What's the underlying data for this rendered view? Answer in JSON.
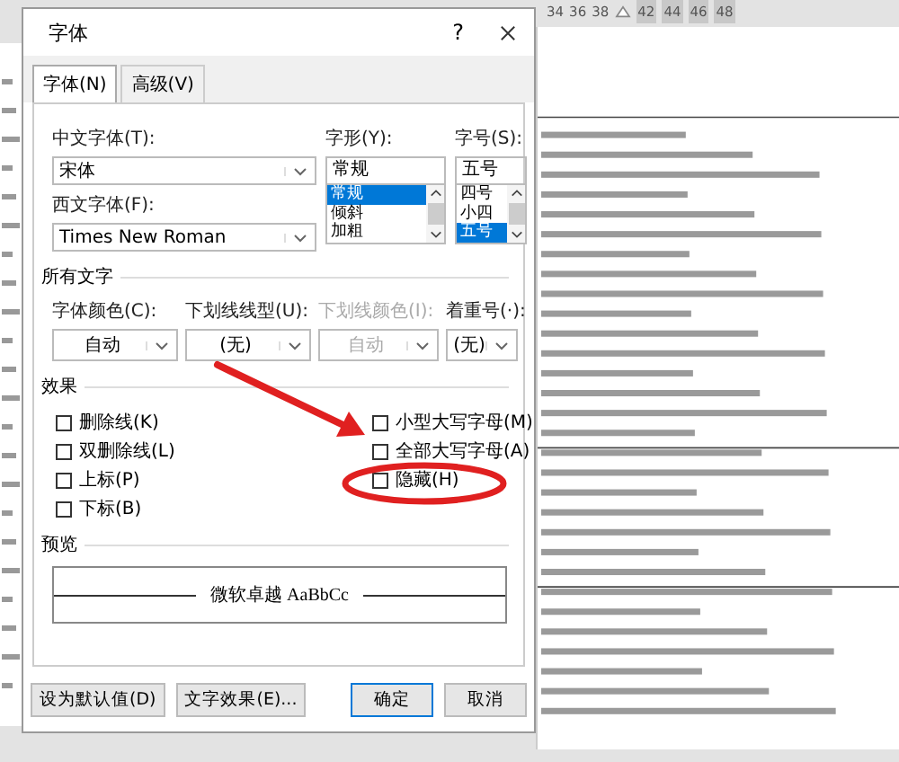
{
  "ruler": {
    "numbers": [
      "34",
      "36",
      "38",
      "42",
      "44",
      "46",
      "48"
    ]
  },
  "dialog": {
    "title": "字体",
    "help": "?",
    "tabs": [
      {
        "label": "字体(N)",
        "selected": true
      },
      {
        "label": "高级(V)",
        "selected": false
      }
    ],
    "chinese_font": {
      "label": "中文字体(T):",
      "value": "宋体"
    },
    "western_font": {
      "label": "西文字体(F):",
      "value": "Times New Roman"
    },
    "style": {
      "label": "字形(Y):",
      "value": "常规",
      "options": [
        {
          "text": "常规",
          "selected": true
        },
        {
          "text": "倾斜",
          "selected": false
        },
        {
          "text": "加粗",
          "selected": false
        }
      ]
    },
    "size": {
      "label": "字号(S):",
      "value": "五号",
      "options": [
        {
          "text": "四号",
          "selected": false
        },
        {
          "text": "小四",
          "selected": false
        },
        {
          "text": "五号",
          "selected": true
        }
      ]
    },
    "all_text": {
      "heading": "所有文字",
      "fields": [
        {
          "label": "字体颜色(C):",
          "value": "自动",
          "disabled": false
        },
        {
          "label": "下划线线型(U):",
          "value": "(无)",
          "disabled": false
        },
        {
          "label": "下划线颜色(I):",
          "value": "自动",
          "disabled": true
        },
        {
          "label": "着重号(·):",
          "value": "(无)",
          "disabled": false
        }
      ]
    },
    "effects": {
      "heading": "效果",
      "left": [
        {
          "label": "删除线(K)",
          "checked": false
        },
        {
          "label": "双删除线(L)",
          "checked": false
        },
        {
          "label": "上标(P)",
          "checked": false
        },
        {
          "label": "下标(B)",
          "checked": false
        }
      ],
      "right": [
        {
          "label": "小型大写字母(M)",
          "checked": false
        },
        {
          "label": "全部大写字母(A)",
          "checked": false
        },
        {
          "label": "隐藏(H)",
          "checked": false
        }
      ]
    },
    "preview": {
      "heading": "预览",
      "sample": "微软卓越 AaBbCc"
    },
    "buttons": [
      {
        "label": "设为默认值(D)",
        "kind": "left",
        "default": false
      },
      {
        "label": "文字效果(E)...",
        "kind": "left",
        "default": false
      },
      {
        "label": "确定",
        "kind": "right",
        "default": true
      },
      {
        "label": "取消",
        "kind": "right",
        "default": false
      }
    ]
  }
}
